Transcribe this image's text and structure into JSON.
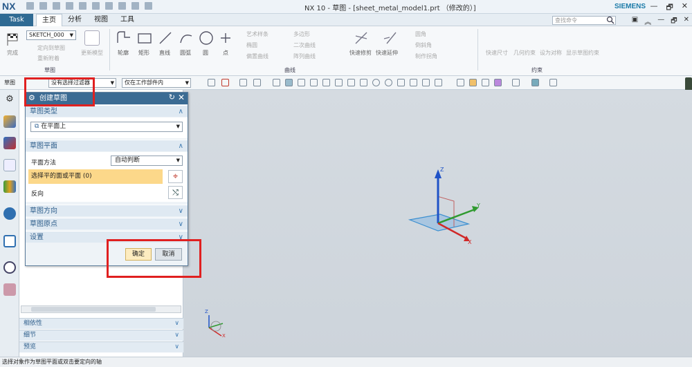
{
  "titlebar": {
    "logo": "NX",
    "title": "NX 10 - 草图 - [sheet_metal_model1.prt （修改的）]",
    "brand": "SIEMENS",
    "win_min": "—",
    "win_restore": "🗗",
    "win_close": "✕"
  },
  "menubar": {
    "task": "Task",
    "tabs": [
      "主页",
      "分析",
      "视图",
      "工具"
    ],
    "active_tab": "主页",
    "search_placeholder": "查找命令",
    "right_icons": [
      "▣",
      "︽",
      "—",
      "🗗",
      "✕"
    ]
  },
  "ribbon": {
    "sketch_name": "SKETCH_000",
    "groups": {
      "sketch": "草图",
      "curve": "曲线",
      "constraint": "约束"
    },
    "sketch_buttons": [
      "完成",
      "定向到草图",
      "重新附着",
      "更新模型"
    ],
    "curve_big": [
      "轮廓",
      "矩形",
      "直线",
      "圆弧",
      "圆",
      "点"
    ],
    "curve_small": [
      "艺术样条",
      "多边形",
      "椭圆",
      "二次曲线",
      "偏置曲线",
      "阵列曲线",
      "快速修剪",
      "快速延伸",
      "圆角",
      "倒斜角",
      "制作拐角"
    ],
    "constraint_buttons": [
      "快速尺寸",
      "几何约束",
      "设为对称",
      "显示草图约束"
    ]
  },
  "toolbar2": {
    "sketch_label": "草图",
    "filter": "没有选择过滤器",
    "scope": "仅在工作部件内"
  },
  "dialog": {
    "title": "创建草图",
    "sections": [
      {
        "title": "草图类型",
        "value": "在平面上"
      },
      {
        "title": "草图平面",
        "method_label": "平面方法",
        "method_value": "自动判断",
        "select_label": "选择平的面或平面 (0)",
        "reverse_label": "反向"
      },
      {
        "title": "草图方向"
      },
      {
        "title": "草图原点"
      },
      {
        "title": "设置"
      }
    ],
    "ok": "确定",
    "cancel": "取消"
  },
  "navpanel": {
    "sections": [
      "相依性",
      "细节",
      "预览"
    ]
  },
  "axes": {
    "x": "X",
    "y": "Y",
    "z": "Z"
  },
  "status": "选择对象作为草图平面或双击要定向的轴"
}
